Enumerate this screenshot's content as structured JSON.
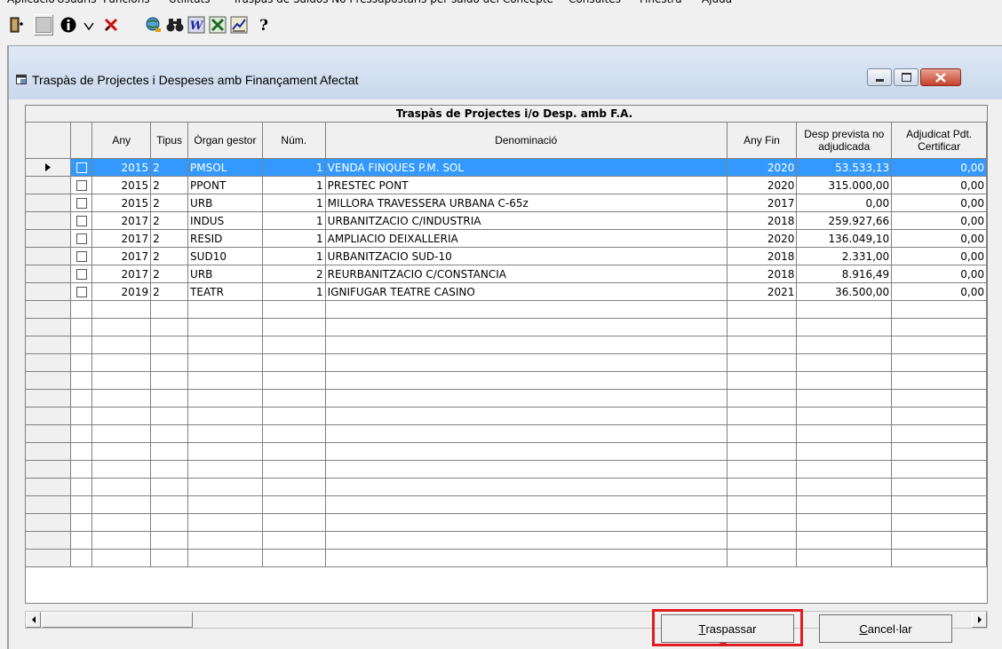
{
  "menubar": [
    "Aplicació",
    "Usuaris",
    "Funcions",
    "Utilitats",
    "Traspàs de Saldos No Pressupostaris per saldo del Concepte",
    "Consultes",
    "Finestra",
    "Ajuda"
  ],
  "toolbar": {
    "icons": [
      "exit-icon",
      "blank-icon",
      "info-icon",
      "check-icon",
      "cancel-x-icon",
      "search-globe-icon",
      "binoculars-icon",
      "word-icon",
      "excel-icon",
      "chart-icon",
      "help-icon"
    ]
  },
  "window": {
    "title": "Traspàs de Projectes i Despeses amb Finançament Afectat"
  },
  "grid": {
    "title": "Traspàs de Projectes i/o Desp. amb F.A.",
    "columns": [
      "",
      "",
      "Any",
      "Tipus",
      "Òrgan gestor",
      "Núm.",
      "Denominació",
      "Any Fin",
      "Desp prevista no adjudicada",
      "Adjudicat Pdt. Certificar"
    ],
    "rows": [
      {
        "any": "2015",
        "tipus": "2",
        "organ": "PMSOL",
        "num": "1",
        "den": "VENDA FINQUES P.M. SOL",
        "anyfin": "2020",
        "desp": "53.533,13",
        "adj": "0,00",
        "selected": true
      },
      {
        "any": "2015",
        "tipus": "2",
        "organ": "PPONT",
        "num": "1",
        "den": "PRESTEC PONT",
        "anyfin": "2020",
        "desp": "315.000,00",
        "adj": "0,00"
      },
      {
        "any": "2015",
        "tipus": "2",
        "organ": "URB",
        "num": "1",
        "den": "MILLORA TRAVESSERA URBANA C-65z",
        "anyfin": "2017",
        "desp": "0,00",
        "adj": "0,00"
      },
      {
        "any": "2017",
        "tipus": "2",
        "organ": "INDUS",
        "num": "1",
        "den": "URBANITZACIO C/INDUSTRIA",
        "anyfin": "2018",
        "desp": "259.927,66",
        "adj": "0,00"
      },
      {
        "any": "2017",
        "tipus": "2",
        "organ": "RESID",
        "num": "1",
        "den": "AMPLIACIO DEIXALLERIA",
        "anyfin": "2020",
        "desp": "136.049,10",
        "adj": "0,00"
      },
      {
        "any": "2017",
        "tipus": "2",
        "organ": "SUD10",
        "num": "1",
        "den": "URBANITZACIO SUD-10",
        "anyfin": "2018",
        "desp": "2.331,00",
        "adj": "0,00"
      },
      {
        "any": "2017",
        "tipus": "2",
        "organ": "URB",
        "num": "2",
        "den": "REURBANITZACIO C/CONSTANCIA",
        "anyfin": "2018",
        "desp": "8.916,49",
        "adj": "0,00"
      },
      {
        "any": "2019",
        "tipus": "2",
        "organ": "TEATR",
        "num": "1",
        "den": "IGNIFUGAR TEATRE CASINO",
        "anyfin": "2021",
        "desp": "36.500,00",
        "adj": "0,00"
      }
    ]
  },
  "buttons": {
    "traspassar": {
      "key": "T",
      "rest": "raspassar"
    },
    "cancelar": {
      "key": "C",
      "rest": "ancel·lar"
    }
  },
  "colors": {
    "selection": "#3399ff",
    "highlight": "#e21b22"
  }
}
